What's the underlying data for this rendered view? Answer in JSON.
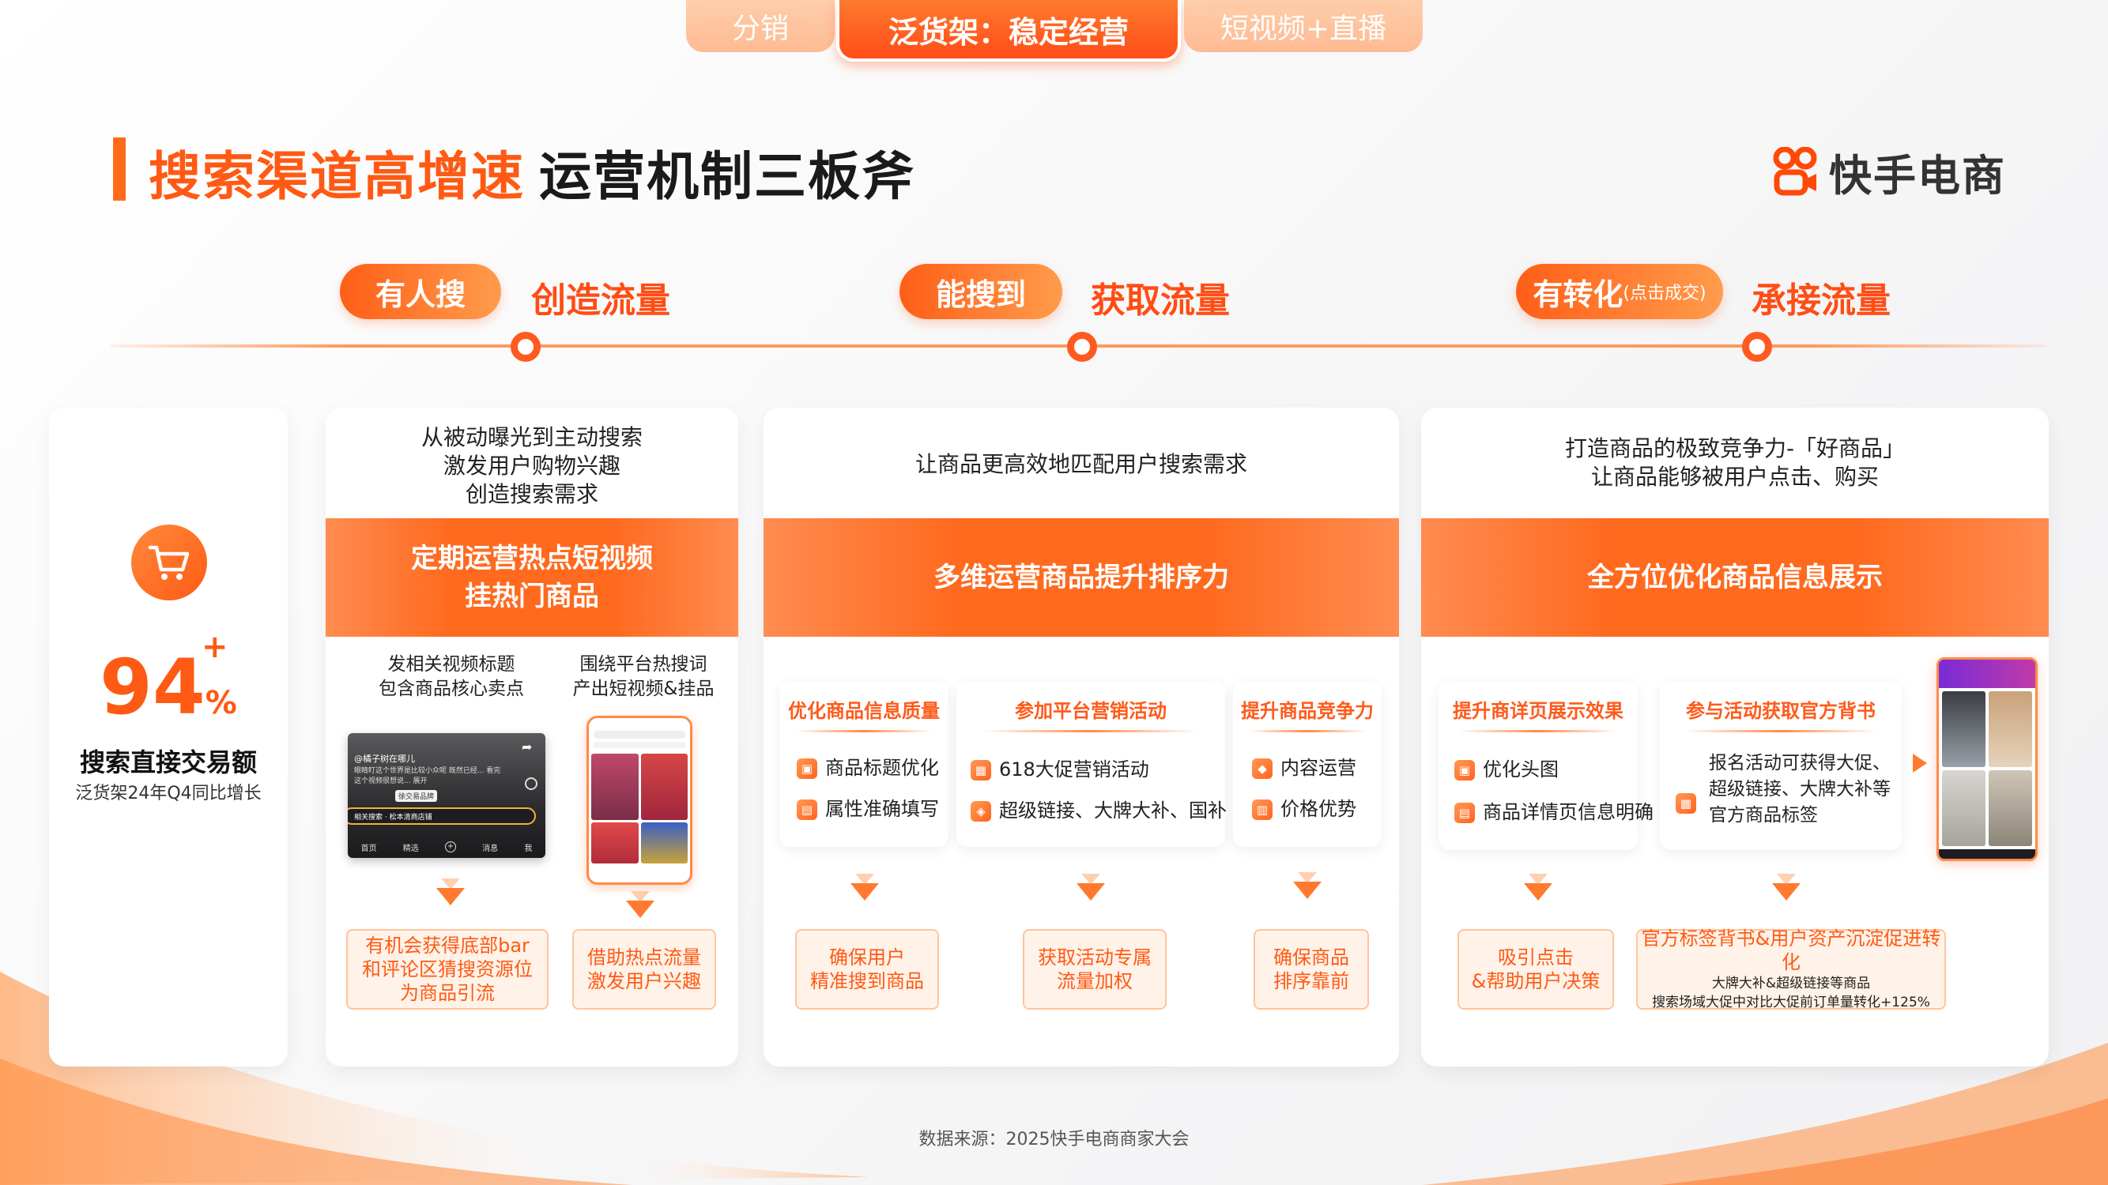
{
  "tabs": [
    {
      "label": "分销"
    },
    {
      "label": "泛货架：稳定经营"
    },
    {
      "label": "短视频+直播"
    }
  ],
  "header": {
    "title_highlight": "搜索渠道高增速",
    "title_rest": "运营机制三板斧",
    "brand": "快手电商"
  },
  "timeline": [
    {
      "pill": "有人搜",
      "pill_small": "",
      "tag": "创造流量"
    },
    {
      "pill": "能搜到",
      "pill_small": "",
      "tag": "获取流量"
    },
    {
      "pill": "有转化",
      "pill_small": "(点击成交)",
      "tag": "承接流量"
    }
  ],
  "stat": {
    "value": "94",
    "plus": "+",
    "percent": "%",
    "label": "搜索直接交易额",
    "sublabel": "泛货架24年Q4同比增长"
  },
  "card1": {
    "top": [
      "从被动曝光到主动搜索",
      "激发用户购物兴趣",
      "创造搜索需求"
    ],
    "band": [
      "定期运营热点短视频",
      "挂热门商品"
    ],
    "cols": [
      {
        "caption": [
          "发相关视频标题",
          "包含商品核心卖点"
        ],
        "result": [
          "有机会获得底部bar",
          "和评论区猜搜资源位",
          "为商品引流"
        ]
      },
      {
        "caption": [
          "围绕平台热搜词",
          "产出短视频&挂品"
        ],
        "result": [
          "借助热点流量",
          "激发用户兴趣"
        ]
      }
    ],
    "video": {
      "author": "@橘子树在哪儿",
      "desc": "眼睛盯这个世界是比较小众呢 既然已经... 看完 这个视频很想说... 展开",
      "chip": "徐交易品牌",
      "search": "相关搜索 · 松本清商店铺",
      "nav": [
        "首页",
        "精选",
        "+",
        "消息",
        "我"
      ]
    }
  },
  "card2": {
    "top": "让商品更高效地匹配用户搜索需求",
    "band": "多维运营商品提升排序力",
    "subs": [
      {
        "title": "优化商品信息质量",
        "items": [
          "商品标题优化",
          "属性准确填写"
        ],
        "result": [
          "确保用户",
          "精准搜到商品"
        ]
      },
      {
        "title": "参加平台营销活动",
        "items": [
          "618大促营销活动",
          "超级链接、大牌大补、国补"
        ],
        "result": [
          "获取活动专属",
          "流量加权"
        ]
      },
      {
        "title": "提升商品竞争力",
        "items": [
          "内容运营",
          "价格优势"
        ],
        "result": [
          "确保商品",
          "排序靠前"
        ]
      }
    ]
  },
  "card3": {
    "top": [
      "打造商品的极致竞争力-「好商品」",
      "让商品能够被用户点击、购买"
    ],
    "band": "全方位优化商品信息展示",
    "subs": [
      {
        "title": "提升商详页展示效果",
        "items": [
          "优化头图",
          "商品详情页信息明确"
        ],
        "result": [
          "吸引点击",
          "&帮助用户决策"
        ]
      },
      {
        "title": "参与活动获取官方背书",
        "items": [
          "报名活动可获得大促、",
          "超级链接、大牌大补等",
          "官方商品标签"
        ],
        "result": [
          "官方标签背书&用户资产沉淀促进转化"
        ],
        "result_small": [
          "大牌大补&超级链接等商品",
          "搜索场域大促中对比大促前订单量转化+125%"
        ]
      }
    ]
  },
  "source": "数据来源：2025快手电商商家大会",
  "colors": {
    "accent": "#ff5a14",
    "accent_light": "#ff9a52"
  }
}
